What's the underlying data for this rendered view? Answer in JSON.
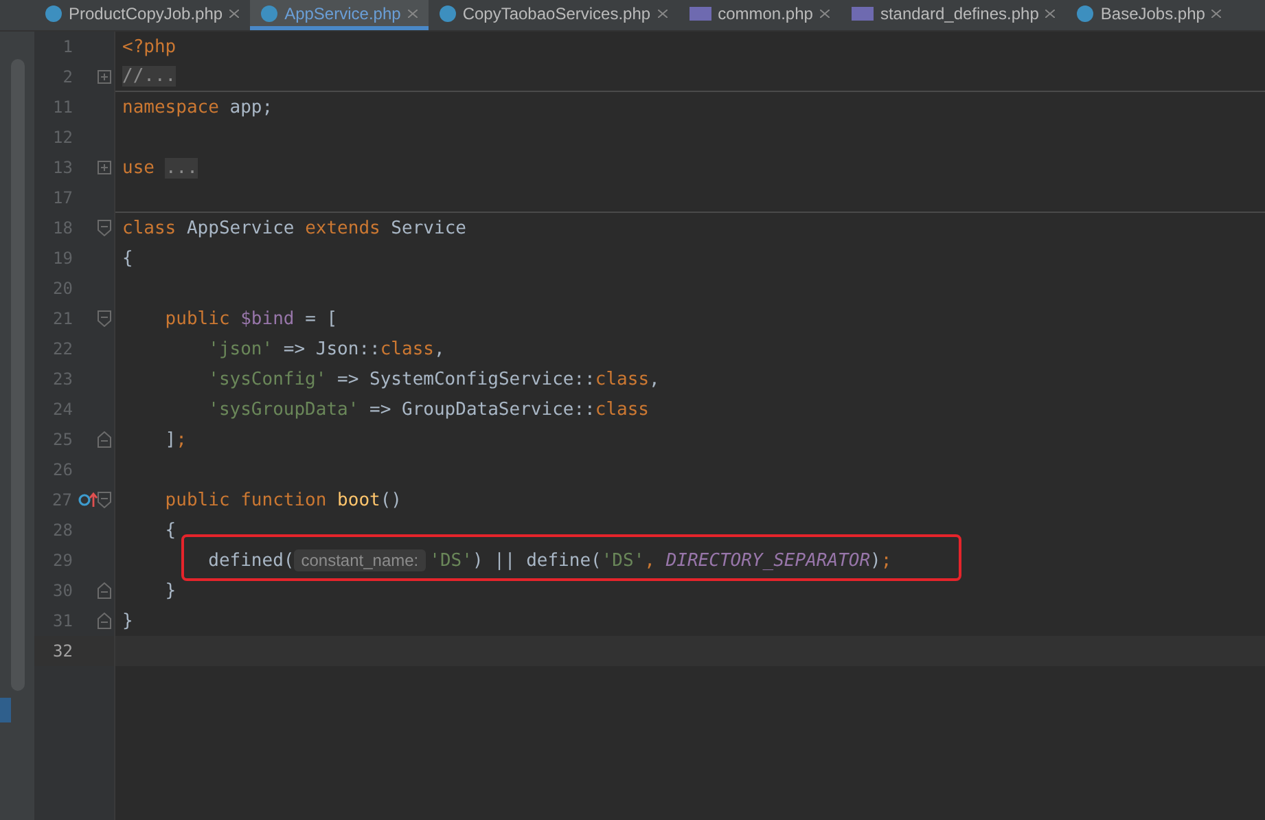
{
  "tabs": [
    {
      "label": "ProductCopyJob.php",
      "kind": "class",
      "selected": false
    },
    {
      "label": "AppService.php",
      "kind": "class",
      "selected": true
    },
    {
      "label": "CopyTaobaoServices.php",
      "kind": "class",
      "selected": false
    },
    {
      "label": "common.php",
      "kind": "php",
      "selected": false
    },
    {
      "label": "standard_defines.php",
      "kind": "php",
      "selected": false
    },
    {
      "label": "BaseJobs.php",
      "kind": "class",
      "selected": false
    }
  ],
  "lines": [
    {
      "number": "1",
      "kind": "plain",
      "tokens": [
        {
          "kind": "keyword",
          "text": "<?php"
        }
      ]
    },
    {
      "number": "2",
      "kind": "folded",
      "separator_after": true,
      "tokens": [
        {
          "kind": "folded",
          "text": "//..."
        }
      ]
    },
    {
      "number": "11",
      "kind": "plain",
      "tokens": [
        {
          "kind": "keyword",
          "text": "namespace"
        },
        {
          "kind": "plain",
          "text": " app;"
        }
      ]
    },
    {
      "number": "12",
      "kind": "plain"
    },
    {
      "number": "13",
      "kind": "folded",
      "tokens": [
        {
          "kind": "keyword",
          "text": "use"
        },
        {
          "kind": "folded",
          "text": "..."
        }
      ]
    },
    {
      "number": "17",
      "kind": "plain",
      "separator_after": true
    },
    {
      "number": "18",
      "kind": "fold-start",
      "tokens": [
        {
          "kind": "keyword",
          "text": "class"
        },
        {
          "kind": "plain",
          "text": " AppService "
        },
        {
          "kind": "keyword",
          "text": "extends"
        },
        {
          "kind": "plain",
          "text": " Service"
        }
      ]
    },
    {
      "number": "19",
      "kind": "plain",
      "tokens": [
        {
          "kind": "plain",
          "text": "{"
        }
      ]
    },
    {
      "number": "20",
      "kind": "plain"
    },
    {
      "number": "21",
      "kind": "fold-start",
      "tokens": [
        {
          "kind": "keyword",
          "text": "    public"
        },
        {
          "kind": "variable",
          "text": " $bind"
        },
        {
          "kind": "plain",
          "text": " = ["
        }
      ]
    },
    {
      "number": "22",
      "kind": "plain",
      "tokens": [
        {
          "kind": "string",
          "text": "        'json'"
        },
        {
          "kind": "plain",
          "text": " => Json::"
        },
        {
          "kind": "keyword",
          "text": "class"
        },
        {
          "kind": "plain",
          "text": ","
        }
      ]
    },
    {
      "number": "23",
      "kind": "plain",
      "tokens": [
        {
          "kind": "string",
          "text": "        'sysConfig'"
        },
        {
          "kind": "plain",
          "text": " => SystemConfigService::"
        },
        {
          "kind": "keyword",
          "text": "class"
        },
        {
          "kind": "plain",
          "text": ","
        }
      ]
    },
    {
      "number": "24",
      "kind": "plain",
      "tokens": [
        {
          "kind": "string",
          "text": "        'sysGroupData'"
        },
        {
          "kind": "plain",
          "text": " => GroupDataService::"
        },
        {
          "kind": "keyword",
          "text": "class"
        }
      ]
    },
    {
      "number": "25",
      "kind": "fold-end",
      "tokens": [
        {
          "kind": "plain",
          "text": "    ]"
        },
        {
          "kind": "keyword",
          "text": ";"
        }
      ]
    },
    {
      "number": "26",
      "kind": "plain"
    },
    {
      "number": "27",
      "kind": "fold-start",
      "override_marker": true,
      "tokens": [
        {
          "kind": "keyword",
          "text": "    public function"
        },
        {
          "kind": "function",
          "text": " boot"
        },
        {
          "kind": "plain",
          "text": "()"
        }
      ]
    },
    {
      "number": "28",
      "kind": "plain",
      "tokens": [
        {
          "kind": "plain",
          "text": "    {"
        }
      ]
    },
    {
      "number": "29",
      "kind": "plain",
      "highlighted": true,
      "tokens": [
        {
          "kind": "plain",
          "text": "        defined("
        },
        {
          "kind": "hint",
          "text": "constant_name:"
        },
        {
          "kind": "string",
          "text": "'DS'"
        },
        {
          "kind": "plain",
          "text": ") || define("
        },
        {
          "kind": "string",
          "text": "'DS'"
        },
        {
          "kind": "keyword",
          "text": ","
        },
        {
          "kind": "constant",
          "text": " DIRECTORY_SEPARATOR"
        },
        {
          "kind": "plain",
          "text": ")"
        },
        {
          "kind": "keyword",
          "text": ";"
        }
      ]
    },
    {
      "number": "30",
      "kind": "fold-end",
      "tokens": [
        {
          "kind": "plain",
          "text": "    }"
        }
      ]
    },
    {
      "number": "31",
      "kind": "fold-end",
      "tokens": [
        {
          "kind": "plain",
          "text": "}"
        }
      ]
    },
    {
      "number": "32",
      "kind": "plain",
      "current": true
    }
  ]
}
